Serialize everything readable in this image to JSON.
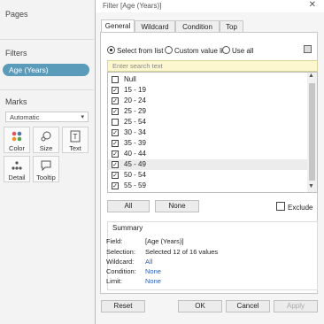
{
  "left_panel": {
    "pages_label": "Pages",
    "filters_label": "Filters",
    "filter_pill": "Age (Years)",
    "marks_label": "Marks",
    "mark_type": "Automatic",
    "mark_buttons": [
      {
        "label": "Color",
        "icon": "color-dots-icon"
      },
      {
        "label": "Size",
        "icon": "size-icon"
      },
      {
        "label": "Text",
        "icon": "text-T-icon"
      },
      {
        "label": "Detail",
        "icon": "detail-dots-icon"
      },
      {
        "label": "Tooltip",
        "icon": "speech-bubble-icon"
      }
    ]
  },
  "dialog": {
    "title": "Filter [Age (Years)]",
    "close_glyph": "✕",
    "tabs": [
      "General",
      "Wildcard",
      "Condition",
      "Top"
    ],
    "active_tab": "General",
    "radio_options": [
      {
        "label": "Select from list",
        "selected": true
      },
      {
        "label": "Custom value list",
        "selected": false
      },
      {
        "label": "Use all",
        "selected": false
      }
    ],
    "search_placeholder": "Enter search text",
    "items": [
      {
        "label": "Null",
        "checked": false
      },
      {
        "label": "15 - 19",
        "checked": true
      },
      {
        "label": "20 - 24",
        "checked": true
      },
      {
        "label": "25 - 29",
        "checked": true
      },
      {
        "label": "25 - 54",
        "checked": false
      },
      {
        "label": "30 - 34",
        "checked": true
      },
      {
        "label": "35 - 39",
        "checked": true
      },
      {
        "label": "40 - 44",
        "checked": true
      },
      {
        "label": "45 - 49",
        "checked": true
      },
      {
        "label": "50 - 54",
        "checked": true
      },
      {
        "label": "55 - 59",
        "checked": true
      }
    ],
    "all_label": "All",
    "none_label": "None",
    "exclude_label": "Exclude",
    "summary": {
      "title": "Summary",
      "field_key": "Field:",
      "field_val": "[Age (Years)]",
      "selection_key": "Selection:",
      "selection_val": "Selected 12 of 16 values",
      "wildcard_key": "Wildcard:",
      "wildcard_val": "All",
      "condition_key": "Condition:",
      "condition_val": "None",
      "limit_key": "Limit:",
      "limit_val": "None"
    },
    "buttons": {
      "reset": "Reset",
      "ok": "OK",
      "cancel": "Cancel",
      "apply": "Apply"
    }
  }
}
